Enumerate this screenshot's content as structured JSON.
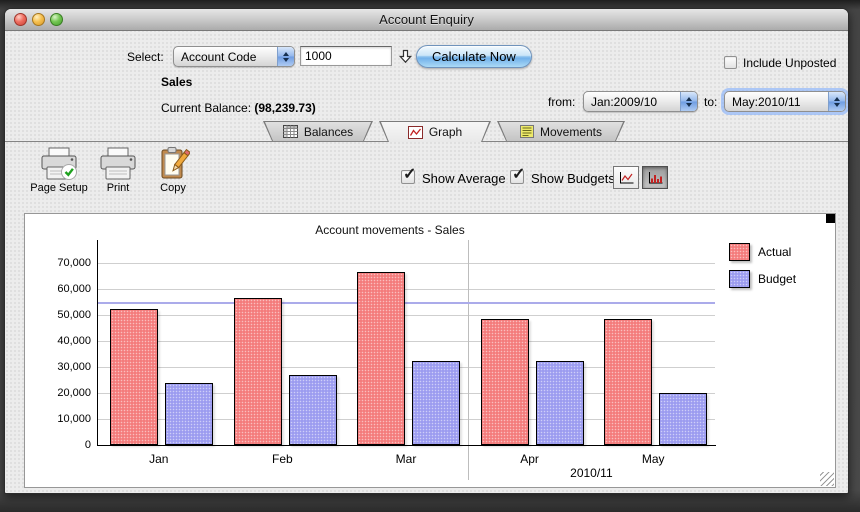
{
  "window": {
    "title": "Account Enquiry"
  },
  "header": {
    "select_label": "Select:",
    "select_value": "Account Code",
    "account_code": "1000",
    "calculate_label": "Calculate Now",
    "include_unposted_label": "Include Unposted",
    "include_unposted_checked": false,
    "account_name": "Sales",
    "balance_label": "Current Balance:",
    "balance_value": "(98,239.73)",
    "from_label": "from:",
    "from_value": "Jan:2009/10",
    "to_label": "to:",
    "to_value": "May:2010/11"
  },
  "tabs": [
    {
      "label": "Balances",
      "active": false
    },
    {
      "label": "Graph",
      "active": true
    },
    {
      "label": "Movements",
      "active": false
    }
  ],
  "toolbar": {
    "page_setup_label": "Page Setup",
    "print_label": "Print",
    "copy_label": "Copy",
    "show_average_label": "Show Average",
    "show_average_checked": true,
    "show_budgets_label": "Show Budgets",
    "show_budgets_checked": true,
    "line_chart_button_selected": false,
    "bar_chart_button_selected": true
  },
  "icons": {
    "traffic": [
      "close-icon",
      "minimize-icon",
      "zoom-icon"
    ],
    "balances_tab": "grid-table-icon",
    "graph_tab": "line-chart-icon",
    "movements_tab": "list-document-icon",
    "page_setup": "printer-check-icon",
    "print": "printer-icon",
    "copy": "clipboard-pencil-icon",
    "field_drop": "hollow-down-arrow-icon",
    "chart_type": [
      "line-chart-icon",
      "bar-chart-icon"
    ]
  },
  "colors": {
    "actual": "#F47C7C",
    "budget": "#9C9CF0",
    "average_line": "#ABABEA",
    "aqua_accent": "#8FC2EF"
  },
  "chart_data": {
    "type": "bar",
    "title": "Account movements - Sales",
    "categories": [
      "Jan",
      "Feb",
      "Mar",
      "Apr",
      "May"
    ],
    "series": [
      {
        "name": "Actual",
        "color": "#F47C7C",
        "values": [
          52500,
          56500,
          66500,
          48500,
          48500
        ]
      },
      {
        "name": "Budget",
        "color": "#9C9CF0",
        "values": [
          24000,
          27000,
          32500,
          32500,
          20000
        ]
      }
    ],
    "average_line": {
      "value": 54500,
      "color": "#ABABEA"
    },
    "ylim": [
      0,
      70000
    ],
    "ytick_step": 10000,
    "grid": true,
    "group_divider_after": "Mar",
    "group_label": "2010/11",
    "legend": [
      "Actual",
      "Budget"
    ],
    "legend_position": "top-right"
  }
}
